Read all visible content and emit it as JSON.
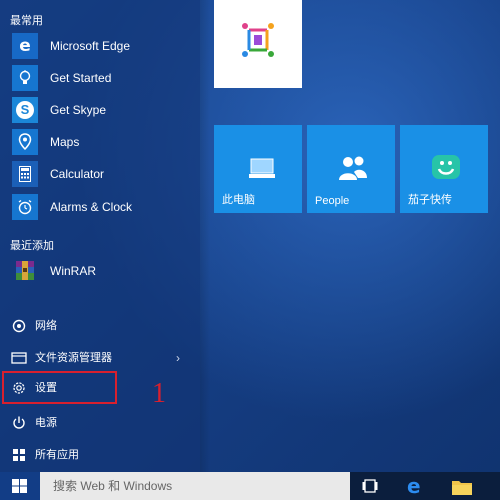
{
  "start_menu": {
    "most_used_header": "最常用",
    "most_used": [
      {
        "label": "Microsoft Edge",
        "icon": "edge-icon"
      },
      {
        "label": "Get Started",
        "icon": "lightbulb-icon"
      },
      {
        "label": "Get Skype",
        "icon": "skype-icon"
      },
      {
        "label": "Maps",
        "icon": "maps-icon"
      },
      {
        "label": "Calculator",
        "icon": "calculator-icon"
      },
      {
        "label": "Alarms & Clock",
        "icon": "alarm-clock-icon"
      }
    ],
    "recently_added_header": "最近添加",
    "recently_added": [
      {
        "label": "WinRAR",
        "icon": "winrar-icon"
      }
    ],
    "system_items": [
      {
        "label": "网络",
        "icon": "network-icon"
      },
      {
        "label": "文件资源管理器",
        "icon": "file-explorer-icon",
        "has_arrow": true
      },
      {
        "label": "设置",
        "icon": "gear-icon"
      },
      {
        "label": "电源",
        "icon": "power-icon"
      },
      {
        "label": "所有应用",
        "icon": "all-apps-icon"
      }
    ],
    "annotation": "1"
  },
  "tiles": [
    {
      "label": "",
      "icon": "app-logo-icon",
      "color": "#ffffff"
    },
    {
      "label": "此电脑",
      "icon": "computer-icon",
      "color": "#1a90e6"
    },
    {
      "label": "People",
      "icon": "people-icon",
      "color": "#1a90e6"
    },
    {
      "label": "茄子快传",
      "icon": "share-icon",
      "color": "#1a90e6"
    }
  ],
  "taskbar": {
    "search_placeholder": "搜索 Web 和 Windows",
    "icons": [
      "windows-logo-icon",
      "task-view-icon",
      "edge-icon",
      "folder-icon"
    ]
  },
  "colors": {
    "desktop_blue": "#163f86",
    "tile_blue": "#1a90e6",
    "highlight_red": "#d8202e"
  }
}
